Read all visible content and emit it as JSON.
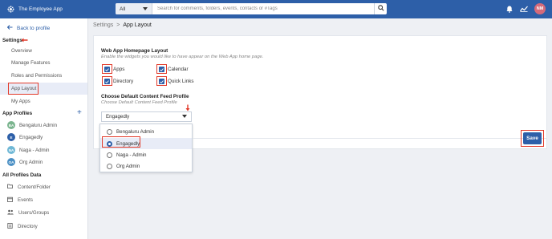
{
  "header": {
    "app_name": "The Employee App",
    "search_scope": "All",
    "search_placeholder": "Search for comments, folders, events, contacts or #Tags",
    "user_initials": "NM",
    "colors": {
      "primary": "#2d5fa8",
      "avatar": "#d56a7a",
      "highlight": "#e23a2a"
    }
  },
  "sidebar": {
    "back_label": "Back to profile",
    "settings_title": "Settings",
    "settings_items": [
      "Overview",
      "Manage Features",
      "Roles and Permissions",
      "App Layout",
      "My Apps"
    ],
    "profiles_title": "App Profiles",
    "profiles": [
      {
        "initials": "BA",
        "label": "Bengaluru Admin",
        "color": "#7bb58f"
      },
      {
        "initials": "E",
        "label": "Engagedly",
        "color": "#2d5fa8"
      },
      {
        "initials": "NA",
        "label": "Naga - Admin",
        "color": "#6fb8d6"
      },
      {
        "initials": "OA",
        "label": "Org Admin",
        "color": "#4a8fc4"
      }
    ],
    "data_title": "All Profiles Data",
    "data_items": [
      {
        "label": "Content/Folder",
        "icon": "folder-icon"
      },
      {
        "label": "Events",
        "icon": "calendar-icon"
      },
      {
        "label": "Users/Groups",
        "icon": "users-icon"
      },
      {
        "label": "Directory",
        "icon": "directory-icon"
      }
    ]
  },
  "breadcrumb": {
    "parent": "Settings",
    "separator": ">",
    "current": "App Layout"
  },
  "layout_section": {
    "title": "Web App Homepage Layout",
    "subtitle": "Enable the widgets you would like to have appear on the Web App home page.",
    "checkboxes": [
      {
        "label": "Apps",
        "checked": true
      },
      {
        "label": "Calendar",
        "checked": true
      },
      {
        "label": "Directory",
        "checked": true
      },
      {
        "label": "Quick Links",
        "checked": true
      }
    ]
  },
  "feed_section": {
    "title": "Choose Default Content Feed Profile",
    "subtitle": "Choose Default Content Feed Profile",
    "selected": "Engagedly",
    "options": [
      "Bengaluru Admin",
      "Engagedly",
      "Naga - Admin",
      "Org Admin"
    ]
  },
  "save_label": "Save"
}
